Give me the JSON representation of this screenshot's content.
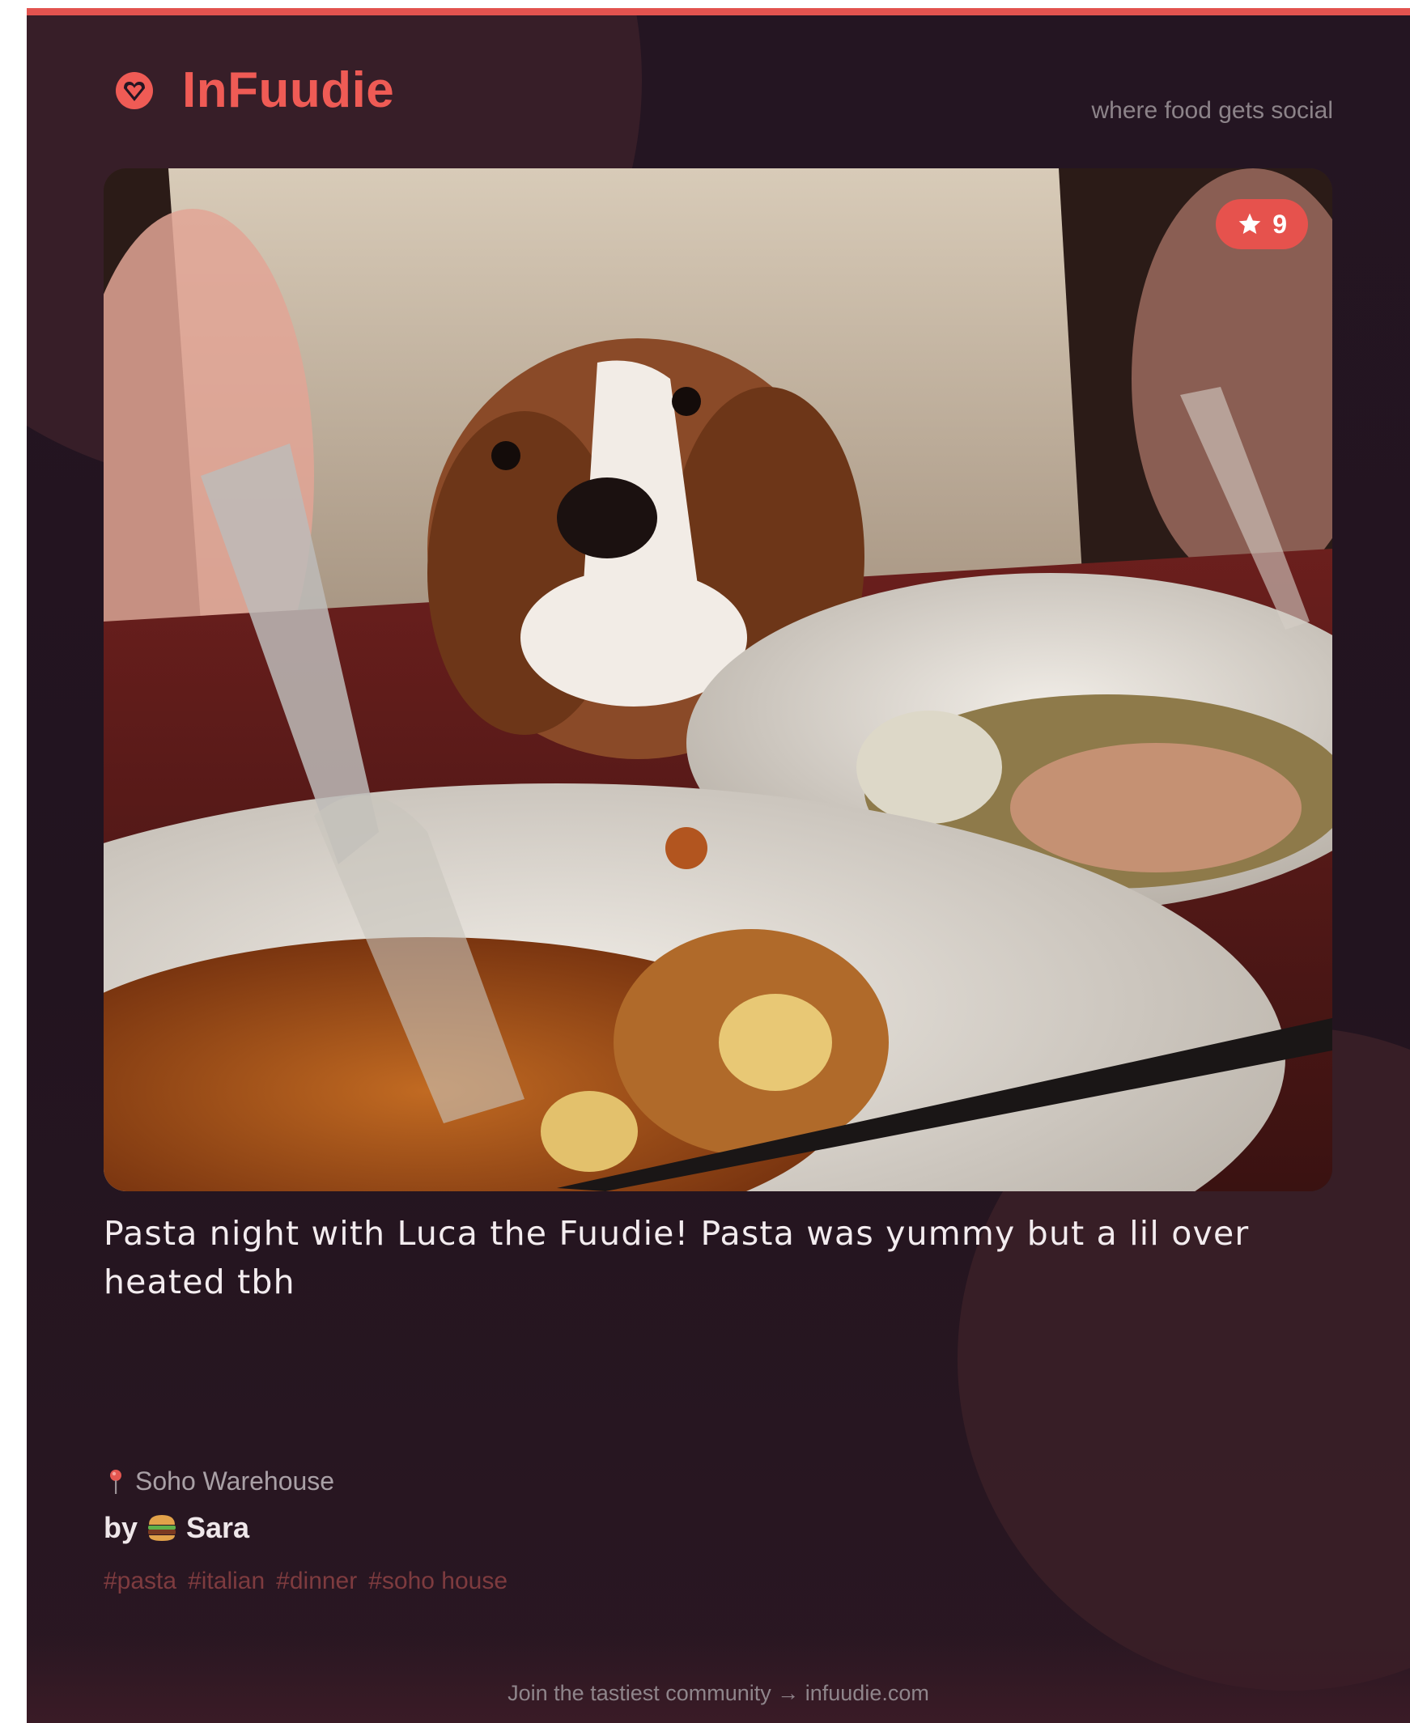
{
  "brand": {
    "name": "InFuudie",
    "tagline": "where food gets social",
    "logo_icon": "heart-badge-icon",
    "accent_color": "#ef5b55"
  },
  "post": {
    "image_alt": "Dog peeking over a table with pasta plates",
    "rating": "9",
    "rating_icon": "star-icon",
    "caption": "Pasta night with Luca the Fuudie! Pasta was yummy but a lil over heated tbh",
    "location": {
      "icon": "map-pin-icon",
      "name": "Soho Warehouse"
    },
    "author": {
      "prefix": "by",
      "icon": "burger-icon",
      "name": "Sara"
    },
    "tags": [
      "#pasta",
      "#italian",
      "#dinner",
      "#soho house"
    ]
  },
  "footer": {
    "text": "Join the tastiest community → infuudie.com"
  },
  "colors": {
    "background": "#241522",
    "badge": "#e6524d",
    "tag": "#7e3b3f",
    "muted_text": "#8f858b"
  }
}
